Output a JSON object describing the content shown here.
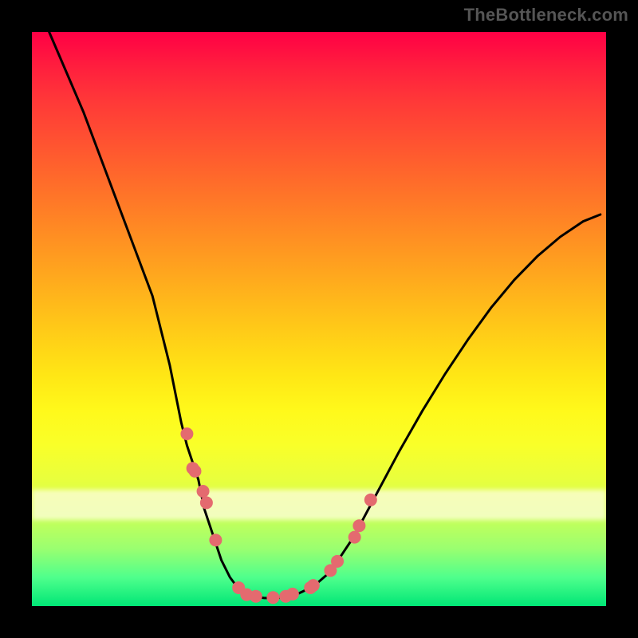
{
  "watermark": "TheBottleneck.com",
  "colors": {
    "curve": "#000000",
    "marker_fill": "#e46a6f",
    "background_frame": "#000000",
    "gradient_top": "#ff0045",
    "gradient_mid1": "#ff8a00",
    "gradient_mid2": "#ffee00",
    "gradient_bottom": "#00e676",
    "highlight_band": "#fffde0"
  },
  "chart_data": {
    "type": "line",
    "title": "",
    "xlabel": "",
    "ylabel": "",
    "xlim": [
      0,
      100
    ],
    "ylim": [
      0,
      100
    ],
    "grid": false,
    "series": [
      {
        "name": "curve",
        "x": [
          3,
          6,
          9,
          12,
          15,
          18,
          21,
          24,
          26,
          27,
          29,
          30,
          32,
          33,
          34.5,
          36,
          37.5,
          39,
          40.5,
          42,
          44,
          46,
          49,
          52,
          56,
          60,
          64,
          68,
          72,
          76,
          80,
          84,
          88,
          92,
          96,
          99
        ],
        "y": [
          100,
          93,
          86,
          78,
          70,
          62,
          54,
          42,
          32,
          28,
          22,
          17,
          11,
          8,
          5,
          3,
          2,
          1.6,
          1.4,
          1.4,
          1.5,
          2,
          3.4,
          6,
          12,
          19.5,
          27,
          34,
          40.5,
          46.5,
          52,
          56.8,
          60.9,
          64.3,
          67,
          68.2
        ]
      }
    ],
    "markers": {
      "name": "data-points",
      "x": [
        27,
        28,
        28.4,
        29.8,
        30.4,
        32,
        36,
        37.4,
        39,
        42,
        44.2,
        45.4,
        48.5,
        49,
        52,
        53.2,
        56.2,
        57,
        59
      ],
      "y": [
        30,
        24,
        23.5,
        20,
        18,
        11.5,
        3.2,
        2,
        1.7,
        1.5,
        1.7,
        2.1,
        3.2,
        3.6,
        6.2,
        7.8,
        12,
        14,
        18.5
      ]
    }
  }
}
